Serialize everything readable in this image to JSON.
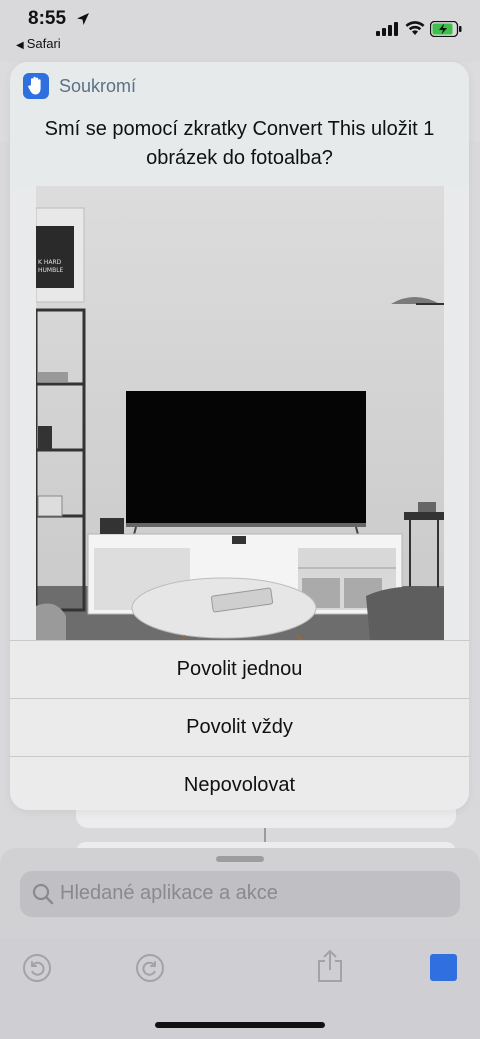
{
  "status_bar": {
    "time": "8:55",
    "back_app": "Safari",
    "back_glyph": "◀"
  },
  "alert": {
    "app_name": "Soukromí",
    "question": "Smí se pomocí zkratky Convert This uložit 1 obrázek do fotoalba?",
    "photo_description_poster_text": "K HARD HUMBLE",
    "actions": [
      {
        "label": "Povolit jednou"
      },
      {
        "label": "Povolit vždy"
      },
      {
        "label": "Nepovolovat"
      }
    ]
  },
  "search": {
    "placeholder": "Hledané aplikace a akce"
  },
  "toolbar": {
    "items": [
      "undo-icon",
      "redo-icon",
      "share-icon",
      "stop-icon"
    ]
  },
  "colors": {
    "accent": "#2f6fe0",
    "app_name": "#5b7186"
  }
}
